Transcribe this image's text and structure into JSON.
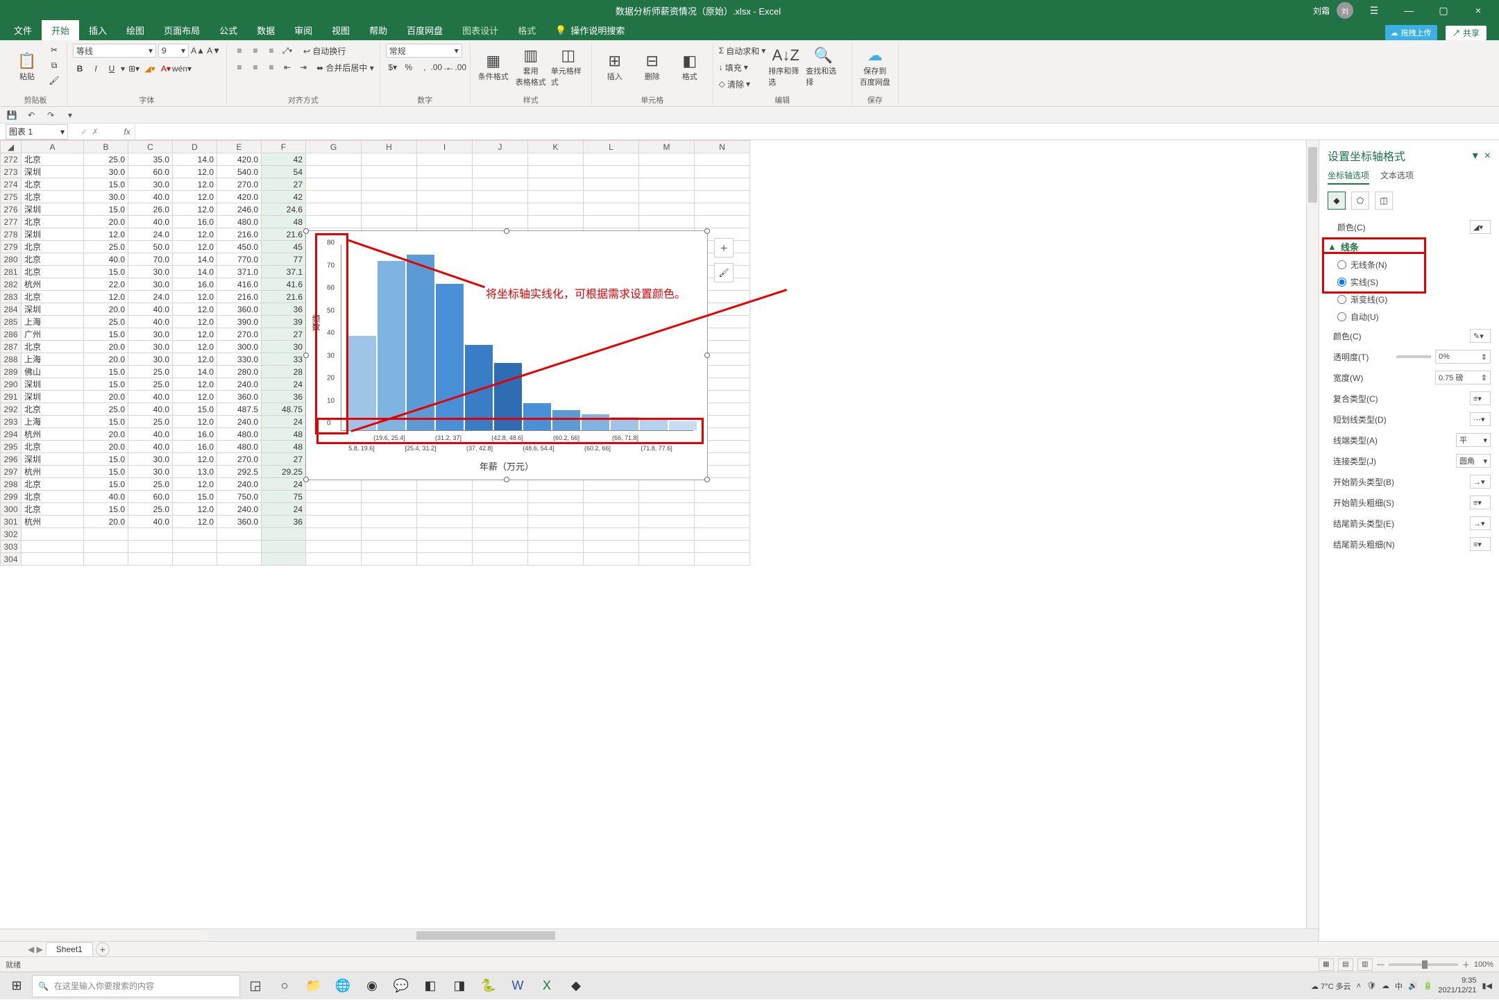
{
  "title": {
    "filename": "数据分析师薪资情况（原始）.xlsx - Excel",
    "username": "刘霜",
    "cloud_btn": "拖拽上传",
    "share": "共享"
  },
  "tabs": {
    "file": "文件",
    "home": "开始",
    "insert": "插入",
    "draw": "绘图",
    "layout": "页面布局",
    "formulas": "公式",
    "data": "数据",
    "review": "审阅",
    "view": "视图",
    "help": "帮助",
    "baidu": "百度网盘",
    "chart_design": "图表设计",
    "format": "格式",
    "tell_me": "操作说明搜索"
  },
  "ribbon": {
    "clipboard": {
      "paste": "粘贴",
      "group": "剪贴板"
    },
    "font": {
      "name": "等线",
      "size": "9",
      "group": "字体"
    },
    "align": {
      "wrap": "自动换行",
      "merge": "合并后居中",
      "group": "对齐方式"
    },
    "number": {
      "fmt": "常规",
      "group": "数字"
    },
    "styles": {
      "cond": "条件格式",
      "table": "套用\n表格格式",
      "cell": "单元格样式",
      "group": "样式"
    },
    "cells": {
      "insert": "插入",
      "delete": "删除",
      "format": "格式",
      "group": "单元格"
    },
    "editing": {
      "sum": "自动求和",
      "fill": "填充",
      "clear": "清除",
      "sort": "排序和筛选",
      "find": "查找和选择",
      "group": "编辑"
    },
    "save": {
      "baidu": "保存到\n百度网盘",
      "group": "保存"
    }
  },
  "namebox": "图表 1",
  "columns": [
    "A",
    "B",
    "C",
    "D",
    "E",
    "F",
    "G",
    "H",
    "I",
    "J",
    "K",
    "L",
    "M",
    "N"
  ],
  "rows": [
    {
      "n": 272,
      "a": "北京",
      "b": "25.0",
      "c": "35.0",
      "d": "14.0",
      "e": "420.0",
      "f": "42"
    },
    {
      "n": 273,
      "a": "深圳",
      "b": "30.0",
      "c": "60.0",
      "d": "12.0",
      "e": "540.0",
      "f": "54"
    },
    {
      "n": 274,
      "a": "北京",
      "b": "15.0",
      "c": "30.0",
      "d": "12.0",
      "e": "270.0",
      "f": "27"
    },
    {
      "n": 275,
      "a": "北京",
      "b": "30.0",
      "c": "40.0",
      "d": "12.0",
      "e": "420.0",
      "f": "42"
    },
    {
      "n": 276,
      "a": "深圳",
      "b": "15.0",
      "c": "26.0",
      "d": "12.0",
      "e": "246.0",
      "f": "24.6"
    },
    {
      "n": 277,
      "a": "北京",
      "b": "20.0",
      "c": "40.0",
      "d": "16.0",
      "e": "480.0",
      "f": "48"
    },
    {
      "n": 278,
      "a": "深圳",
      "b": "12.0",
      "c": "24.0",
      "d": "12.0",
      "e": "216.0",
      "f": "21.6"
    },
    {
      "n": 279,
      "a": "北京",
      "b": "25.0",
      "c": "50.0",
      "d": "12.0",
      "e": "450.0",
      "f": "45"
    },
    {
      "n": 280,
      "a": "北京",
      "b": "40.0",
      "c": "70.0",
      "d": "14.0",
      "e": "770.0",
      "f": "77"
    },
    {
      "n": 281,
      "a": "北京",
      "b": "15.0",
      "c": "30.0",
      "d": "14.0",
      "e": "371.0",
      "f": "37.1"
    },
    {
      "n": 282,
      "a": "杭州",
      "b": "22.0",
      "c": "30.0",
      "d": "16.0",
      "e": "416.0",
      "f": "41.6"
    },
    {
      "n": 283,
      "a": "北京",
      "b": "12.0",
      "c": "24.0",
      "d": "12.0",
      "e": "216.0",
      "f": "21.6"
    },
    {
      "n": 284,
      "a": "深圳",
      "b": "20.0",
      "c": "40.0",
      "d": "12.0",
      "e": "360.0",
      "f": "36"
    },
    {
      "n": 285,
      "a": "上海",
      "b": "25.0",
      "c": "40.0",
      "d": "12.0",
      "e": "390.0",
      "f": "39"
    },
    {
      "n": 286,
      "a": "广州",
      "b": "15.0",
      "c": "30.0",
      "d": "12.0",
      "e": "270.0",
      "f": "27"
    },
    {
      "n": 287,
      "a": "北京",
      "b": "20.0",
      "c": "30.0",
      "d": "12.0",
      "e": "300.0",
      "f": "30"
    },
    {
      "n": 288,
      "a": "上海",
      "b": "20.0",
      "c": "30.0",
      "d": "12.0",
      "e": "330.0",
      "f": "33"
    },
    {
      "n": 289,
      "a": "佛山",
      "b": "15.0",
      "c": "25.0",
      "d": "14.0",
      "e": "280.0",
      "f": "28"
    },
    {
      "n": 290,
      "a": "深圳",
      "b": "15.0",
      "c": "25.0",
      "d": "12.0",
      "e": "240.0",
      "f": "24"
    },
    {
      "n": 291,
      "a": "深圳",
      "b": "20.0",
      "c": "40.0",
      "d": "12.0",
      "e": "360.0",
      "f": "36"
    },
    {
      "n": 292,
      "a": "北京",
      "b": "25.0",
      "c": "40.0",
      "d": "15.0",
      "e": "487.5",
      "f": "48.75"
    },
    {
      "n": 293,
      "a": "上海",
      "b": "15.0",
      "c": "25.0",
      "d": "12.0",
      "e": "240.0",
      "f": "24"
    },
    {
      "n": 294,
      "a": "杭州",
      "b": "20.0",
      "c": "40.0",
      "d": "16.0",
      "e": "480.0",
      "f": "48"
    },
    {
      "n": 295,
      "a": "北京",
      "b": "20.0",
      "c": "40.0",
      "d": "16.0",
      "e": "480.0",
      "f": "48"
    },
    {
      "n": 296,
      "a": "深圳",
      "b": "15.0",
      "c": "30.0",
      "d": "12.0",
      "e": "270.0",
      "f": "27"
    },
    {
      "n": 297,
      "a": "杭州",
      "b": "15.0",
      "c": "30.0",
      "d": "13.0",
      "e": "292.5",
      "f": "29.25"
    },
    {
      "n": 298,
      "a": "北京",
      "b": "15.0",
      "c": "25.0",
      "d": "12.0",
      "e": "240.0",
      "f": "24"
    },
    {
      "n": 299,
      "a": "北京",
      "b": "40.0",
      "c": "60.0",
      "d": "15.0",
      "e": "750.0",
      "f": "75"
    },
    {
      "n": 300,
      "a": "北京",
      "b": "15.0",
      "c": "25.0",
      "d": "12.0",
      "e": "240.0",
      "f": "24"
    },
    {
      "n": 301,
      "a": "杭州",
      "b": "20.0",
      "c": "40.0",
      "d": "12.0",
      "e": "360.0",
      "f": "36"
    },
    {
      "n": 302,
      "a": "",
      "b": "",
      "c": "",
      "d": "",
      "e": "",
      "f": ""
    },
    {
      "n": 303,
      "a": "",
      "b": "",
      "c": "",
      "d": "",
      "e": "",
      "f": ""
    },
    {
      "n": 304,
      "a": "",
      "b": "",
      "c": "",
      "d": "",
      "e": "",
      "f": ""
    }
  ],
  "chart_data": {
    "type": "bar",
    "categories_upper": [
      "(19.6, 25.4]",
      "(31.2, 37]",
      "(42.8, 48.6]",
      "(60.2, 66]"
    ],
    "categories_lower": [
      "5.8, 19.6]",
      "[25.4, 31.2]",
      "(37, 42.8]",
      "(48.6, 54.4]",
      "(60.2, 66]",
      "(71.8, 77.6]"
    ],
    "categories_upper_last": "(66, 71.8]",
    "values": [
      42,
      75,
      78,
      65,
      38,
      30,
      12,
      9,
      7,
      6,
      5,
      4
    ],
    "xlabel": "年薪（万元）",
    "ylabel": "频数",
    "yticks": [
      0,
      10,
      20,
      30,
      40,
      50,
      60,
      70,
      80
    ]
  },
  "annotation": {
    "text": "将坐标轴实线化，可根据需求设置颜色。"
  },
  "right_pane": {
    "title": "设置坐标轴格式",
    "tab_axis": "坐标轴选项",
    "tab_text": "文本选项",
    "color_top": "颜色(C)",
    "line_section": "线条",
    "opt_none": "无线条(N)",
    "opt_solid": "实线(S)",
    "opt_grad": "渐变线(G)",
    "opt_auto": "自动(U)",
    "l_color": "颜色(C)",
    "l_trans": "透明度(T)",
    "v_trans": "0%",
    "l_width": "宽度(W)",
    "v_width": "0.75 磅",
    "l_compound": "复合类型(C)",
    "l_dash": "短划线类型(D)",
    "l_cap": "线端类型(A)",
    "v_cap": "平",
    "l_join": "连接类型(J)",
    "v_join": "圆角",
    "l_arrow_begin_type": "开始箭头类型(B)",
    "l_arrow_begin_size": "开始箭头粗细(S)",
    "l_arrow_end_type": "结尾箭头类型(E)",
    "l_arrow_end_size": "结尾箭头粗细(N)"
  },
  "sheet": {
    "tab1": "Sheet1"
  },
  "status": {
    "ready": "就绪",
    "zoom": "100%"
  },
  "taskbar": {
    "search_placeholder": "在这里输入你要搜索的内容",
    "weather": "7°C 多云",
    "ime": "中",
    "time": "9:35",
    "date": "2021/12/21"
  }
}
